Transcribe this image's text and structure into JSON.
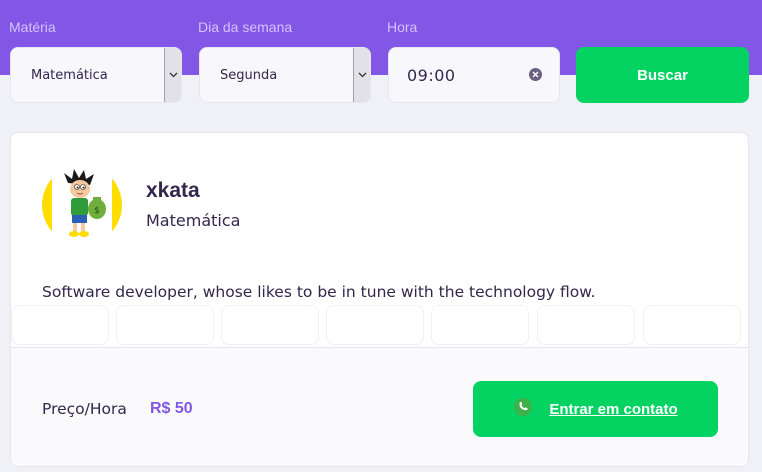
{
  "filters": {
    "subject": {
      "label": "Matéria",
      "value": "Matemática"
    },
    "weekday": {
      "label": "Dia da semana",
      "value": "Segunda"
    },
    "time": {
      "label": "Hora",
      "value": "09:00"
    },
    "search_label": "Buscar"
  },
  "teacher": {
    "name": "xkata",
    "subject": "Matemática",
    "bio": "Software developer, whose likes to be in tune with the technology flow.",
    "price_label": "Preço/Hora",
    "price_value": "R$ 50",
    "contact_label": "Entrar em contato",
    "avatar_icon": "cartoon-boy-avatar"
  },
  "colors": {
    "primary": "#8257e5",
    "secondary": "#04d361",
    "background": "#f0f0f7",
    "text_title": "#32264d"
  }
}
